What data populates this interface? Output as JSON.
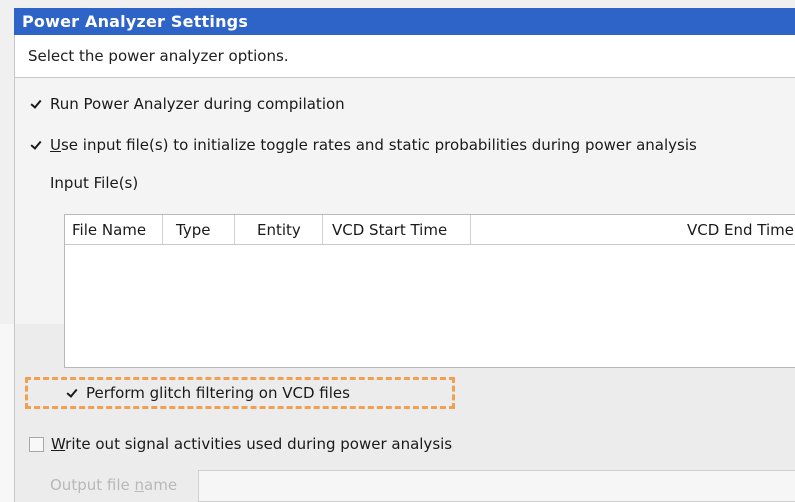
{
  "title": "Power Analyzer Settings",
  "description": "Select the power analyzer options.",
  "options": {
    "run_power_analyzer": {
      "label": "Run Power Analyzer during compilation",
      "checked": true
    },
    "use_input_files": {
      "label_mnemonic": "U",
      "label_rest": "se input file(s) to initialize toggle rates and static probabilities during power analysis",
      "checked": true
    },
    "glitch_filtering": {
      "label": "Perform glitch filtering on VCD files",
      "checked": true
    },
    "write_signal_activities": {
      "label_mnemonic": "W",
      "label_rest": "rite out signal activities used during power analysis",
      "checked": false
    }
  },
  "input_files": {
    "label": "Input File(s)",
    "columns": [
      "File Name",
      "Type",
      "Entity",
      "VCD Start Time",
      "VCD End Time"
    ],
    "rows": []
  },
  "output_file": {
    "label_prefix": "Output file ",
    "label_mnemonic": "n",
    "label_suffix": "ame",
    "value": ""
  },
  "colors": {
    "title_bar": "#2e63c8",
    "highlight_border": "#f0a050"
  },
  "icons": {
    "checkbox_checked": "checkmark-icon"
  }
}
